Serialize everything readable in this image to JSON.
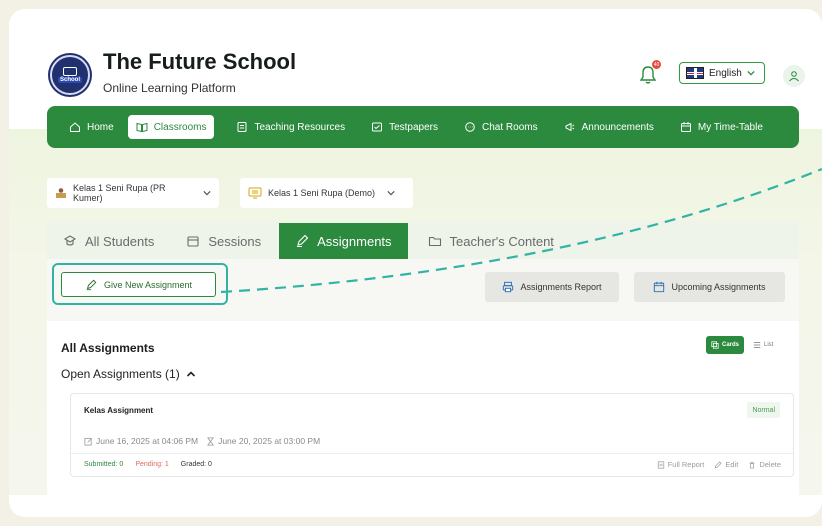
{
  "header": {
    "school_name": "The Future School",
    "subtitle": "Online Learning Platform",
    "logo_text": "School",
    "notifications": "40",
    "language": "English"
  },
  "nav": {
    "items": [
      {
        "label": "Home",
        "icon": "home-icon"
      },
      {
        "label": "Classrooms",
        "icon": "book-icon",
        "active": true
      },
      {
        "label": "Teaching Resources",
        "icon": "document-icon"
      },
      {
        "label": "Testpapers",
        "icon": "test-icon"
      },
      {
        "label": "Chat Rooms",
        "icon": "chat-icon"
      },
      {
        "label": "Announcements",
        "icon": "megaphone-icon"
      },
      {
        "label": "My Time-Table",
        "icon": "calendar-icon"
      }
    ]
  },
  "selectors": {
    "class_primary": "Kelas 1 Seni Rupa (PR Kumer)",
    "class_secondary": "Kelas 1 Seni Rupa (Demo)"
  },
  "tabs": [
    {
      "label": "All Students"
    },
    {
      "label": "Sessions"
    },
    {
      "label": "Assignments",
      "active": true
    },
    {
      "label": "Teacher's Content"
    }
  ],
  "toolbar": {
    "give_new": "Give New Assignment",
    "assignments_report": "Assignments Report",
    "upcoming": "Upcoming Assignments"
  },
  "list": {
    "title": "All Assignments",
    "view_cards": "Cards",
    "view_list": "List",
    "open_title": "Open Assignments (1)"
  },
  "assignment": {
    "title": "Kelas Assignment",
    "badge": "Normal",
    "start": "June 16, 2025 at 04:06 PM",
    "due": "June 20, 2025 at 03:00 PM",
    "submitted": "Submitted: 0",
    "pending": "Pending: 1",
    "graded": "Graded: 0",
    "full_report": "Full Report",
    "edit": "Edit",
    "delete": "Delete"
  },
  "colors": {
    "primary": "#2b8a3e",
    "highlight": "#33b3a4",
    "pending": "#e06a5a"
  }
}
